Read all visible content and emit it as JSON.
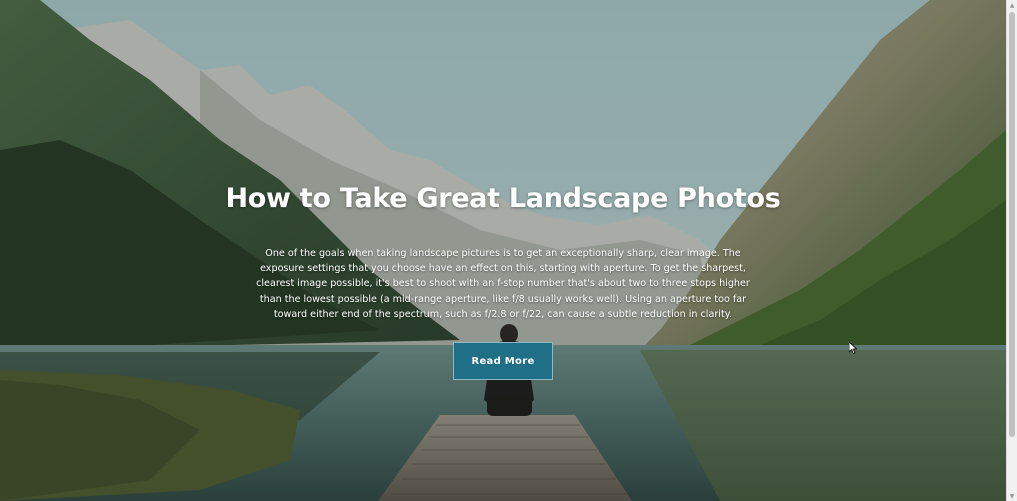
{
  "hero": {
    "title": "How to Take Great Landscape Photos",
    "description": "One of the goals when taking landscape pictures is to get an exceptionally sharp, clear image. The exposure settings that you choose have an effect on this, starting with aperture. To get the sharpest, clearest image possible, it's best to shoot with an f-stop number that's about two to three stops higher than the lowest possible (a mid-range aperture, like f/8 usually works well). Using an aperture too far toward either end of the spectrum, such as f/2.8 or f/22, can cause a subtle reduction in clarity.",
    "button_label": "Read More"
  },
  "colors": {
    "button_bg": "#1f6f86",
    "sky": "#9fc0c4",
    "water": "#3f5f5c"
  },
  "icons": {
    "scroll_up": "triangle-up-icon",
    "scroll_down": "triangle-down-icon",
    "cursor": "mouse-pointer-icon"
  }
}
